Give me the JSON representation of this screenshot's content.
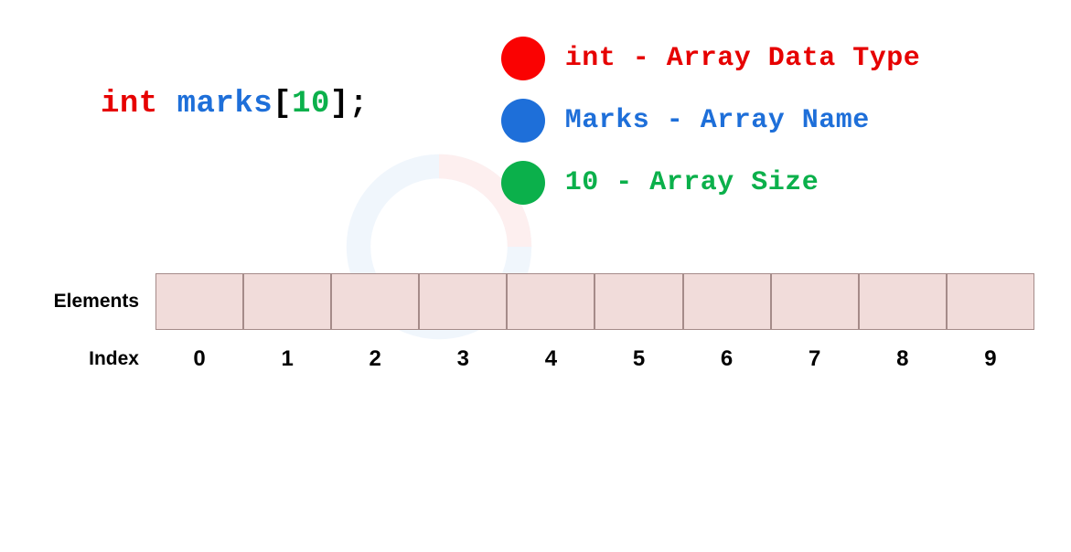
{
  "code": {
    "keyword": "int",
    "name": "marks",
    "open_bracket": "[",
    "size": "10",
    "close_bracket": "]",
    "semicolon": ";"
  },
  "legend": {
    "datatype": "int - Array Data Type",
    "arrayname": "Marks - Array Name",
    "arraysize": "10 - Array Size"
  },
  "labels": {
    "elements": "Elements",
    "index": "Index"
  },
  "indices": [
    "0",
    "1",
    "2",
    "3",
    "4",
    "5",
    "6",
    "7",
    "8",
    "9"
  ]
}
